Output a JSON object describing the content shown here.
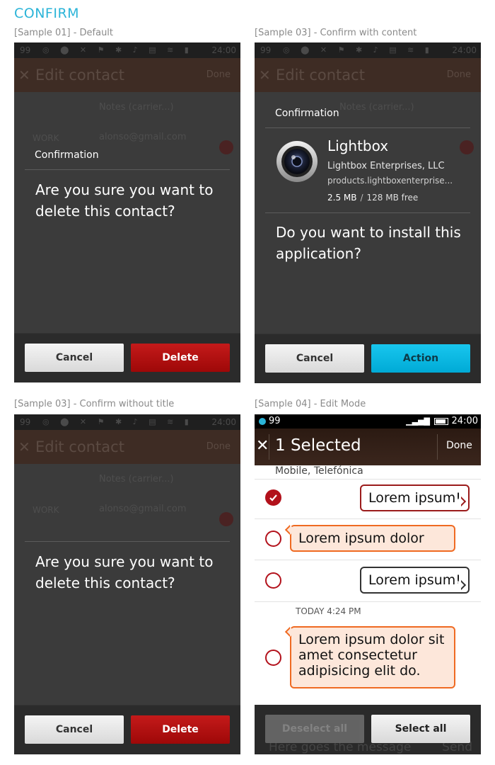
{
  "page_title": "CONFIRM",
  "samples": {
    "s1": {
      "caption": "[Sample 01] - Default"
    },
    "s2": {
      "caption": "[Sample 03] - Confirm with content"
    },
    "s3": {
      "caption": "[Sample 03] - Confirm without title"
    },
    "s4": {
      "caption": "[Sample 04] - Edit Mode"
    }
  },
  "background_app": {
    "status_left": "99",
    "time": "24:00",
    "header_title": "Edit contact",
    "header_done": "Done",
    "notes_placeholder": "Notes (carrier...)",
    "label": "WORK",
    "email": "alonso@gmail.com"
  },
  "dialog_default": {
    "title": "Confirmation",
    "message": "Are you sure you want to delete this contact?",
    "cancel": "Cancel",
    "confirm": "Delete"
  },
  "dialog_content": {
    "title": "Confirmation",
    "app_name": "Lightbox",
    "vendor": "Lightbox Enterprises, LLC",
    "url": "products.lightboxenterprise...",
    "size": "2.5 MB",
    "size_separator": "/",
    "free": "128 MB free",
    "message": "Do you want to install this application?",
    "cancel": "Cancel",
    "confirm": "Action"
  },
  "dialog_no_title": {
    "message": "Are you sure you want to delete this contact?",
    "cancel": "Cancel",
    "confirm": "Delete"
  },
  "edit_mode": {
    "status_notif": "99",
    "time": "24:00",
    "title": "1 Selected",
    "done": "Done",
    "subtitle": "Mobile, Telefónica",
    "messages": [
      {
        "text": "Lorem ipsum!",
        "checked": true
      },
      {
        "text": "Lorem ipsum dolor",
        "checked": false
      },
      {
        "text": "Lorem ipsum!",
        "checked": false
      },
      {
        "text": "Lorem ipsum dolor sit amet consectetur adipisicing elit do.",
        "checked": false
      }
    ],
    "timestamp": "TODAY 4:24 PM",
    "composer_placeholder": "Here goes the message",
    "send": "Send",
    "deselect_all": "Deselect all",
    "select_all": "Select all"
  },
  "colors": {
    "accent": "#2bb4d8",
    "danger": "#b2111b",
    "action": "#00aad6",
    "received_bubble": "#fde7da",
    "received_border": "#ef6a22"
  }
}
